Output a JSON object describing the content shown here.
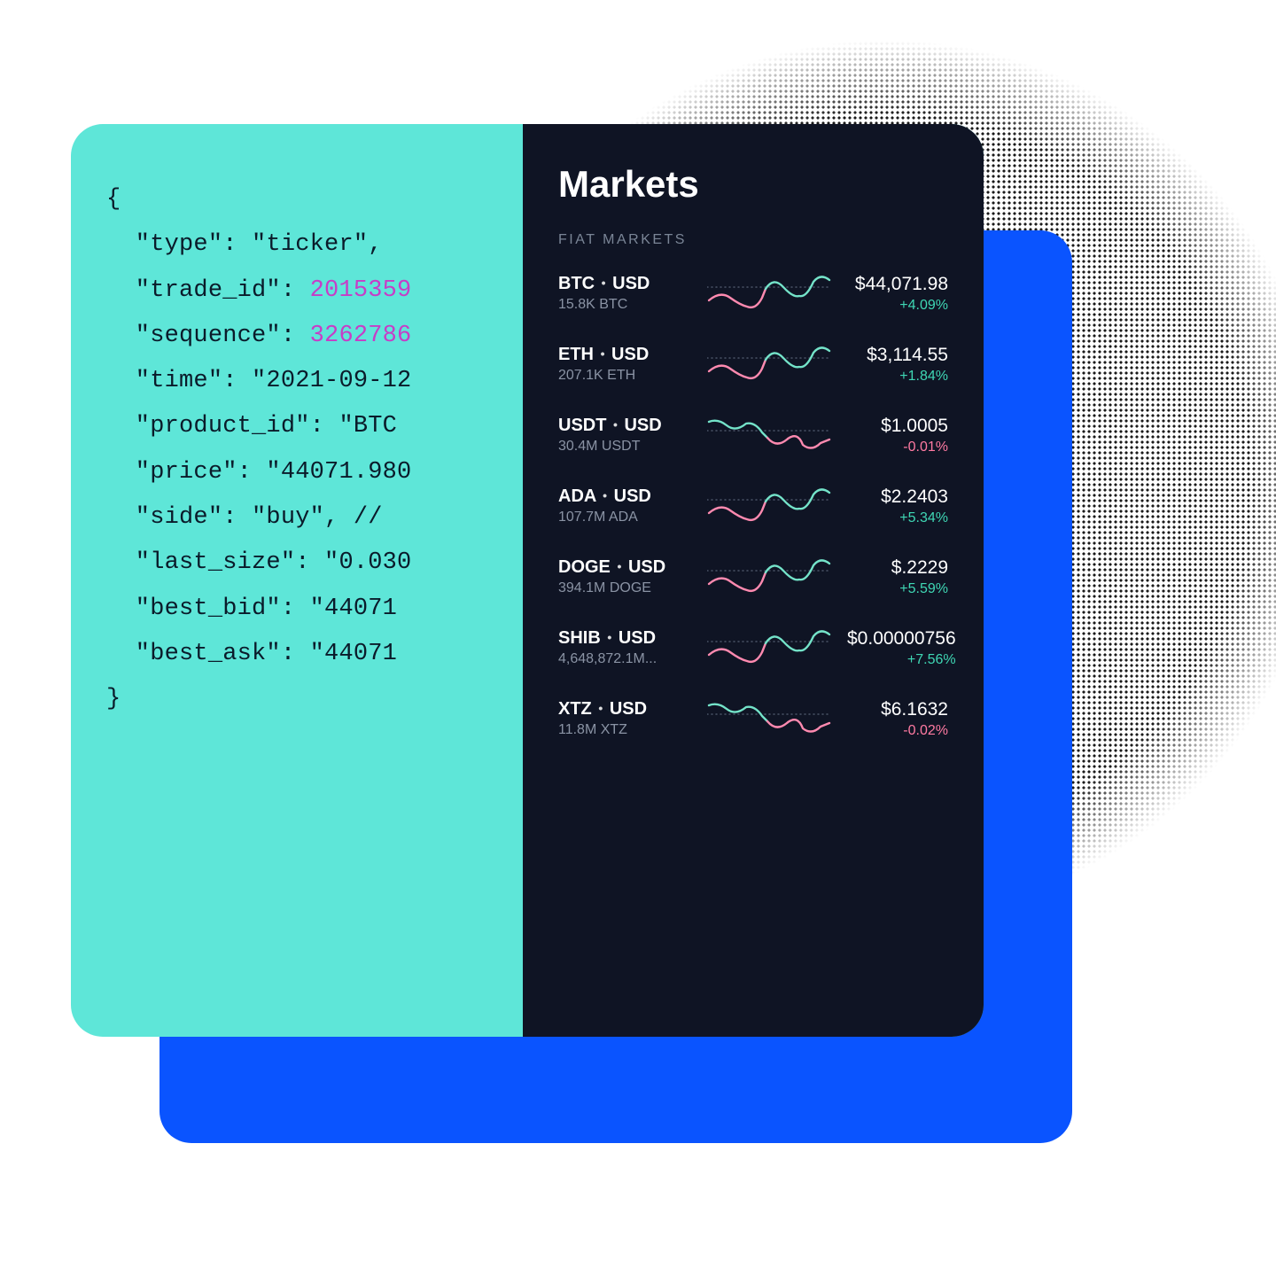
{
  "code": {
    "open": "{",
    "close": "}",
    "indent": "  ",
    "lines": [
      {
        "k": "\"type\"",
        "sep": ": ",
        "v": "\"ticker\", "
      },
      {
        "k": "\"trade_id\"",
        "sep": ": ",
        "v_num": "2015359"
      },
      {
        "k": "\"sequence\"",
        "sep": ": ",
        "v_num": "3262786"
      },
      {
        "k": "\"time\"",
        "sep": ": ",
        "v": "\"2021-09-12"
      },
      {
        "k": "\"product_id\"",
        "sep": ": ",
        "v": "\"BTC"
      },
      {
        "k": "\"price\"",
        "sep": ": ",
        "v": "\"44071.980"
      },
      {
        "k": "\"side\"",
        "sep": ": ",
        "v": "\"buy\", // "
      },
      {
        "k": "\"last_size\"",
        "sep": ": ",
        "v": "\"0.030"
      },
      {
        "k": "\"best_bid\"",
        "sep": ": ",
        "v": "\"44071"
      },
      {
        "k": "\"best_ask\"",
        "sep": ": ",
        "v": "\"44071"
      }
    ]
  },
  "markets": {
    "title": "Markets",
    "subtitle": "FIAT MARKETS",
    "rows": [
      {
        "base": "BTC",
        "quote": "USD",
        "vol": "15.8K BTC",
        "price": "$44,071.98",
        "change": "+4.09%",
        "pos": true
      },
      {
        "base": "ETH",
        "quote": "USD",
        "vol": "207.1K ETH",
        "price": "$3,114.55",
        "change": "+1.84%",
        "pos": true
      },
      {
        "base": "USDT",
        "quote": "USD",
        "vol": "30.4M USDT",
        "price": "$1.0005",
        "change": "-0.01%",
        "pos": false
      },
      {
        "base": "ADA",
        "quote": "USD",
        "vol": "107.7M ADA",
        "price": "$2.2403",
        "change": "+5.34%",
        "pos": true
      },
      {
        "base": "DOGE",
        "quote": "USD",
        "vol": "394.1M DOGE",
        "price": "$.2229",
        "change": "+5.59%",
        "pos": true
      },
      {
        "base": "SHIB",
        "quote": "USD",
        "vol": "4,648,872.1M...",
        "price": "$0.00000756",
        "change": "+7.56%",
        "pos": true
      },
      {
        "base": "XTZ",
        "quote": "USD",
        "vol": "11.8M XTZ",
        "price": "$6.1632",
        "change": "-0.02%",
        "pos": false
      }
    ]
  },
  "colors": {
    "teal": "#5ee6d8",
    "blue": "#0a54ff",
    "dark": "#0f1424",
    "pos": "#3fd7b4",
    "neg": "#ff7aa2"
  }
}
